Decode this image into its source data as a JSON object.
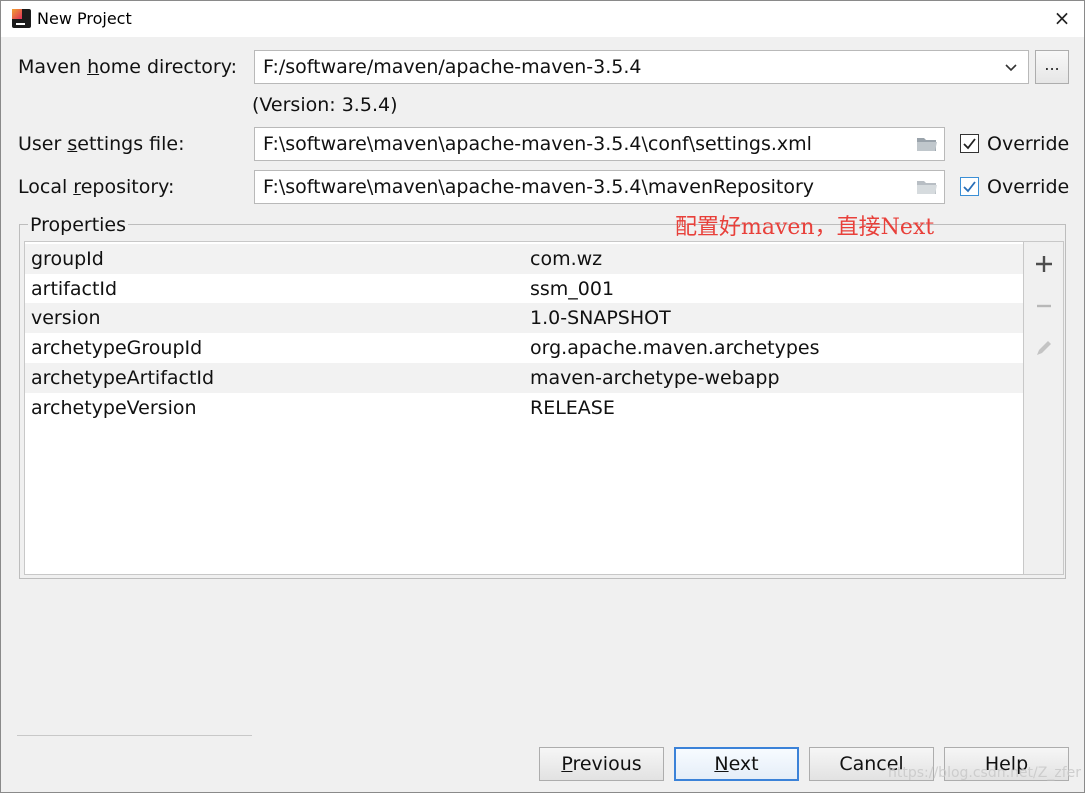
{
  "window": {
    "title": "New Project",
    "close_glyph": "×"
  },
  "maven_home": {
    "label": "Maven home directory:",
    "label_mnemonic_prefix": "Maven ",
    "label_mnemonic_char": "h",
    "label_mnemonic_suffix": "ome directory:",
    "value": "F:/software/maven/apache-maven-3.5.4",
    "browse_label": "...",
    "version_note": "(Version: 3.5.4)"
  },
  "user_settings": {
    "label_prefix": "User ",
    "label_mnemonic_char": "s",
    "label_suffix": "ettings file:",
    "value": "F:\\software\\maven\\apache-maven-3.5.4\\conf\\settings.xml",
    "override_label": "Override",
    "override_checked": true
  },
  "local_repo": {
    "label_prefix": "Local ",
    "label_mnemonic_char": "r",
    "label_suffix": "epository:",
    "value": "F:\\software\\maven\\apache-maven-3.5.4\\mavenRepository",
    "override_label": "Override",
    "override_checked": true
  },
  "properties": {
    "legend": "Properties",
    "rows": [
      {
        "key": "groupId",
        "value": "com.wz"
      },
      {
        "key": "artifactId",
        "value": "ssm_001"
      },
      {
        "key": "version",
        "value": "1.0-SNAPSHOT"
      },
      {
        "key": "archetypeGroupId",
        "value": "org.apache.maven.archetypes"
      },
      {
        "key": "archetypeArtifactId",
        "value": "maven-archetype-webapp"
      },
      {
        "key": "archetypeVersion",
        "value": "RELEASE"
      }
    ],
    "tools": [
      "plus-icon",
      "minus-icon",
      "pencil-icon"
    ]
  },
  "annotation": "配置好maven，直接Next",
  "buttons": {
    "previous": {
      "mnemonic": "P",
      "rest": "revious"
    },
    "next": {
      "mnemonic": "N",
      "rest": "ext"
    },
    "cancel": "Cancel",
    "help": "Help"
  },
  "watermark": "https://blog.csdn.net/Z_zfer",
  "colors": {
    "accent": "#3b82d8",
    "annotation": "#e8403a",
    "checkbox_blue": "#3b8fd6"
  }
}
